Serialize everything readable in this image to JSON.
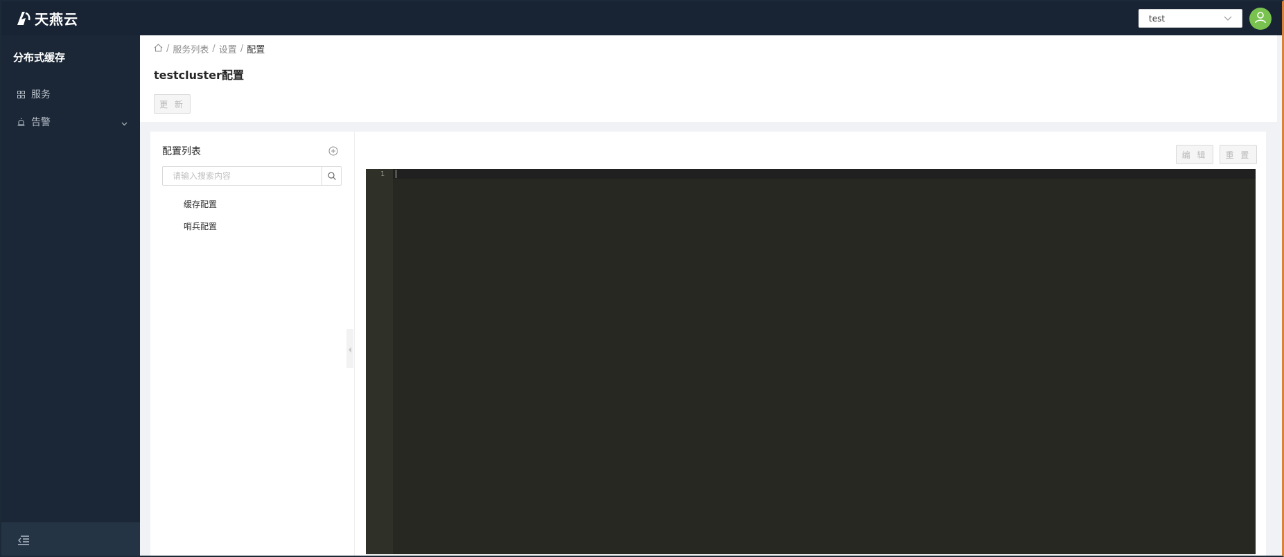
{
  "brand": {
    "name": "天燕云"
  },
  "header": {
    "tenant_value": "test",
    "avatar_color": "#7ac250"
  },
  "sidebar": {
    "title": "分布式缓存",
    "items": [
      {
        "label": "服务",
        "icon": "grid-icon"
      },
      {
        "label": "告警",
        "icon": "alarm-icon",
        "expandable": true
      }
    ],
    "collapse_icon": "menu-fold-icon"
  },
  "breadcrumb": {
    "home_icon": "home-icon",
    "items": [
      "服务列表",
      "设置",
      "配置"
    ],
    "separator": "/"
  },
  "page": {
    "title": "testcluster配置",
    "update_label": "更 新"
  },
  "config_list": {
    "title": "配置列表",
    "search_placeholder": "请输入搜索内容",
    "items": [
      "缓存配置",
      "哨兵配置"
    ]
  },
  "editor": {
    "edit_label": "编 辑",
    "reset_label": "重 置",
    "line_numbers": [
      "1"
    ],
    "content": ""
  },
  "colors": {
    "topbar": "#182434",
    "sidebar": "#1b2736",
    "editor_bg": "#272822",
    "editor_gutter": "#2f3129"
  }
}
